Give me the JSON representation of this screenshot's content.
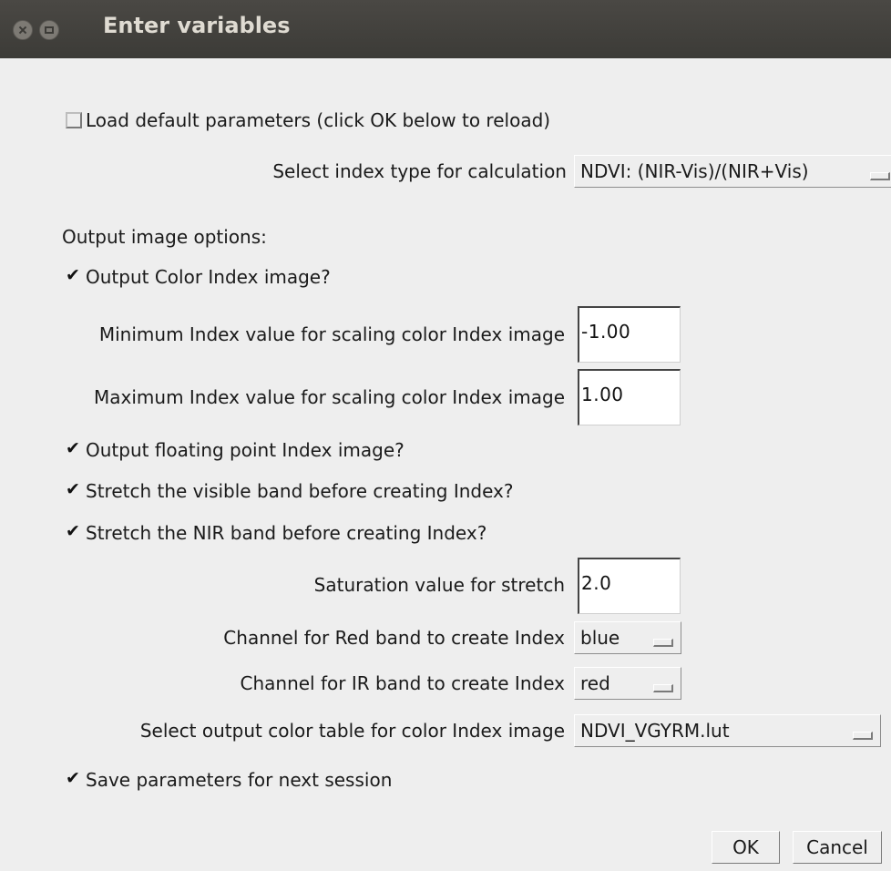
{
  "window": {
    "title": "Enter variables"
  },
  "load_default": {
    "label": "Load default parameters (click OK below to reload)",
    "checked": false
  },
  "index_type": {
    "label": "Select index type for calculation",
    "value": "NDVI: (NIR-Vis)/(NIR+Vis)"
  },
  "output_options_heading": "Output image options:",
  "output_color": {
    "label": "Output Color Index image?",
    "checked": true
  },
  "min_index": {
    "label": "Minimum Index value for scaling color Index image",
    "value": "-1.00"
  },
  "max_index": {
    "label": "Maximum Index value for scaling color Index image",
    "value": "1.00"
  },
  "output_float": {
    "label": "Output floating point Index image?",
    "checked": true
  },
  "stretch_visible": {
    "label": "Stretch the visible band before creating Index?",
    "checked": true
  },
  "stretch_nir": {
    "label": "Stretch the NIR band before creating Index?",
    "checked": true
  },
  "saturation": {
    "label": "Saturation value for stretch",
    "value": "2.0"
  },
  "red_channel": {
    "label": "Channel for Red band to create Index",
    "value": "blue"
  },
  "ir_channel": {
    "label": "Channel for IR band to create Index",
    "value": "red"
  },
  "color_table": {
    "label": "Select output color table for color Index image",
    "value": "NDVI_VGYRM.lut"
  },
  "save_params": {
    "label": "Save parameters for next session",
    "checked": true
  },
  "buttons": {
    "ok": "OK",
    "cancel": "Cancel"
  }
}
